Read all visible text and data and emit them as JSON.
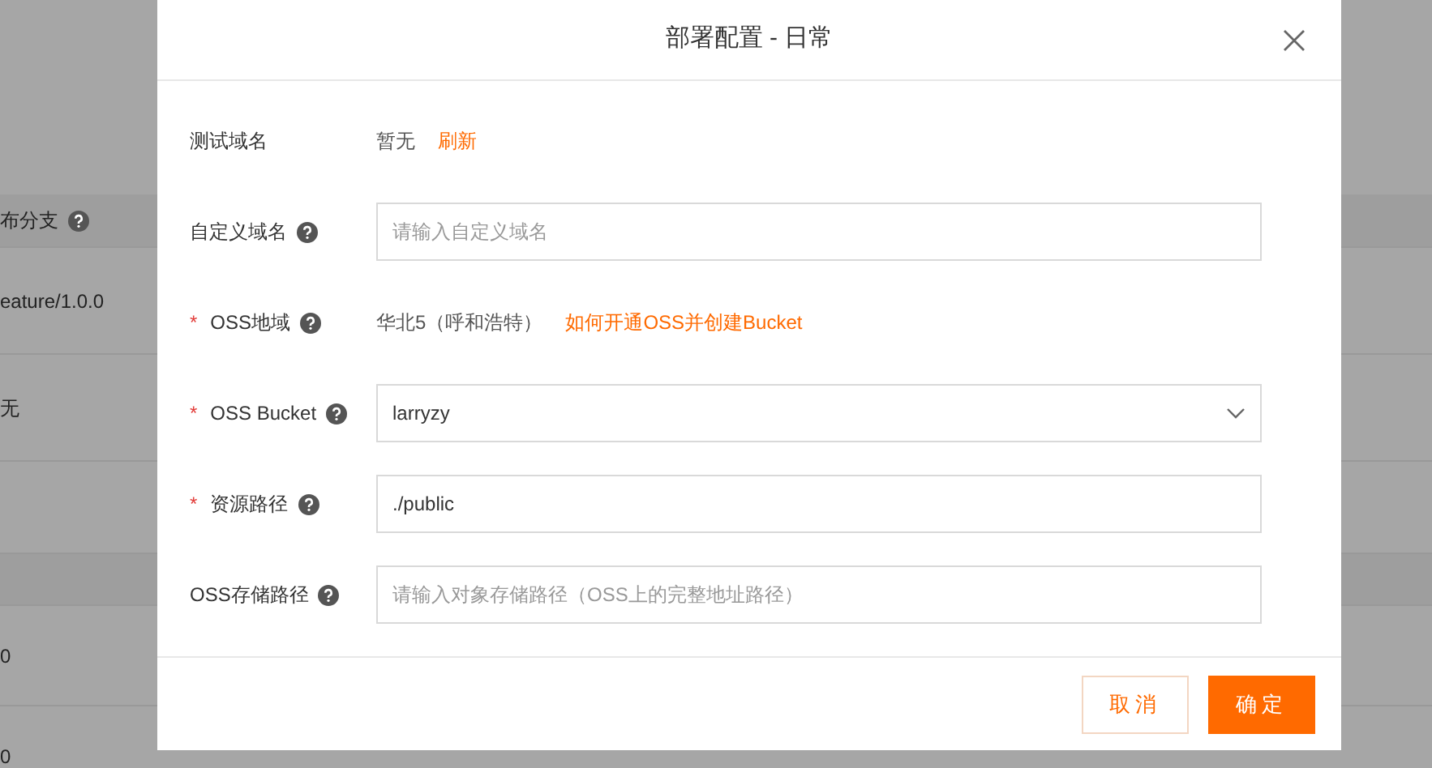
{
  "background_table": {
    "header": {
      "label": "布分支"
    },
    "rows": [
      "eature/1.0.0",
      "无"
    ],
    "rows_2": [
      "0",
      "0"
    ]
  },
  "dialog": {
    "title": "部署配置 - 日常",
    "fields": [
      {
        "kind": "text",
        "label": "测试域名",
        "help": false,
        "value": "暂无",
        "link": "刷新"
      },
      {
        "kind": "input",
        "label": "自定义域名",
        "help": true,
        "placeholder": "请输入自定义域名"
      },
      {
        "kind": "text",
        "label": "OSS地域",
        "required_mark": "*",
        "help": true,
        "value": "华北5（呼和浩特）",
        "link": "如何开通OSS并创建Bucket"
      },
      {
        "kind": "select",
        "label": "OSS Bucket",
        "required_mark": "*",
        "help": true,
        "value": "larryzy"
      },
      {
        "kind": "input",
        "label": "资源路径",
        "required_mark": "*",
        "help": true,
        "value": "./public"
      },
      {
        "kind": "input",
        "label": "OSS存储路径",
        "help": true,
        "placeholder": "请输入对象存储路径（OSS上的完整地址路径）"
      }
    ],
    "buttons": [
      {
        "label": "取消",
        "kind": "secondary"
      },
      {
        "label": "确定",
        "kind": "primary"
      }
    ]
  }
}
